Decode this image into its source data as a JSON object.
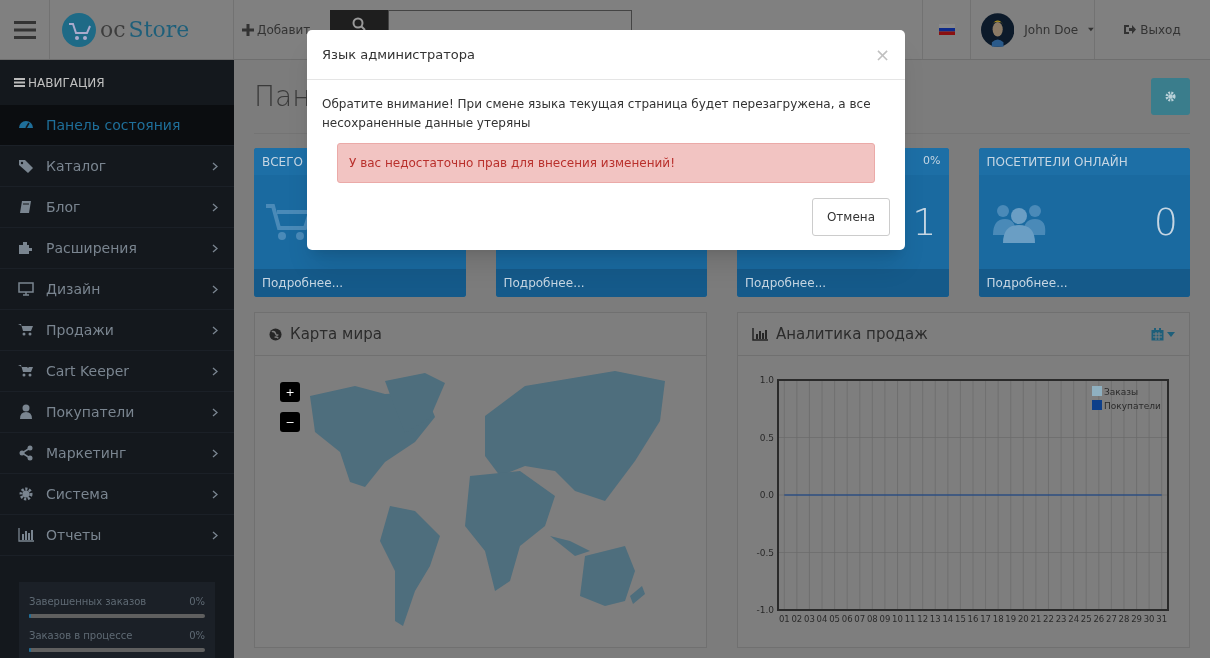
{
  "header": {
    "add_button": "Добавит",
    "logo": {
      "prefix": "oc",
      "name": "Store"
    },
    "user": {
      "name": "John Doe"
    },
    "logout": "Выход"
  },
  "sidebar": {
    "title": "НАВИГАЦИЯ",
    "items": [
      {
        "label": "Панель состояния",
        "selected": true,
        "has_children": false
      },
      {
        "label": "Каталог",
        "selected": false,
        "has_children": true
      },
      {
        "label": "Блог",
        "selected": false,
        "has_children": true
      },
      {
        "label": "Расширения",
        "selected": false,
        "has_children": true
      },
      {
        "label": "Дизайн",
        "selected": false,
        "has_children": true
      },
      {
        "label": "Продажи",
        "selected": false,
        "has_children": true
      },
      {
        "label": "Cart Keeper",
        "selected": false,
        "has_children": true
      },
      {
        "label": "Покупатели",
        "selected": false,
        "has_children": true
      },
      {
        "label": "Маркетинг",
        "selected": false,
        "has_children": true
      },
      {
        "label": "Система",
        "selected": false,
        "has_children": true
      },
      {
        "label": "Отчеты",
        "selected": false,
        "has_children": true
      }
    ],
    "progress": [
      {
        "label": "Завершенных заказов",
        "reading": "0%",
        "level": 0
      },
      {
        "label": "Заказов в процессе",
        "reading": "0%",
        "level": 0
      }
    ]
  },
  "page": {
    "title": "Пан"
  },
  "tiles": [
    {
      "label": "ВСЕГО",
      "footer": "Подробнее..."
    },
    {
      "footer": "Подробнее..."
    },
    {
      "percent": "0%",
      "value": "1",
      "footer": "Подробнее..."
    },
    {
      "label": "ПОСЕТИТЕЛИ ОНЛАЙН",
      "value": "0",
      "footer": "Подробнее..."
    }
  ],
  "map_panel": {
    "title": "Карта мира",
    "zoom_in": "+",
    "zoom_out": "−"
  },
  "chart_panel": {
    "title": "Аналитика продаж",
    "chart_data": {
      "type": "line",
      "categories": [
        "01",
        "02",
        "03",
        "04",
        "05",
        "06",
        "07",
        "08",
        "09",
        "10",
        "11",
        "12",
        "13",
        "14",
        "15",
        "16",
        "17",
        "18",
        "19",
        "20",
        "21",
        "22",
        "23",
        "24",
        "25",
        "26",
        "27",
        "28",
        "29",
        "30",
        "31"
      ],
      "series": [
        {
          "name": "Заказы",
          "color": "#8fb0c0",
          "values": [
            null,
            null,
            null,
            null,
            null,
            null,
            null,
            null,
            null,
            null,
            null,
            null,
            null,
            null,
            null,
            null,
            null,
            null,
            null,
            null,
            null,
            null,
            null,
            null,
            null,
            null,
            null,
            null,
            null,
            null,
            null
          ]
        },
        {
          "name": "Покупатели",
          "color": "#0d3f8a",
          "values": [
            0,
            0,
            0,
            0,
            0,
            0,
            0,
            0,
            0,
            0,
            0,
            0,
            0,
            0,
            0,
            0,
            0,
            0,
            0,
            0,
            0,
            0,
            0,
            0,
            0,
            0,
            0,
            0,
            0,
            0,
            0
          ]
        }
      ],
      "ylim": [
        -1,
        1
      ],
      "grid": true,
      "legend": true,
      "yticks": [
        {
          "value": -1,
          "label": "-1.0"
        },
        {
          "value": -0.5,
          "label": "-0.5"
        },
        {
          "value": 0,
          "label": "0.0"
        },
        {
          "value": 0.5,
          "label": "0.5"
        },
        {
          "value": 1,
          "label": "1.0"
        }
      ]
    }
  },
  "modal": {
    "title": "Язык администратора",
    "close": "×",
    "message": "Обратите внимание! При смене языка текущая страница будет перезагружена, а все несохраненные данные утеряны",
    "alert": "У вас недостаточно прав для внесения изменений!",
    "cancel": "Отмена"
  }
}
